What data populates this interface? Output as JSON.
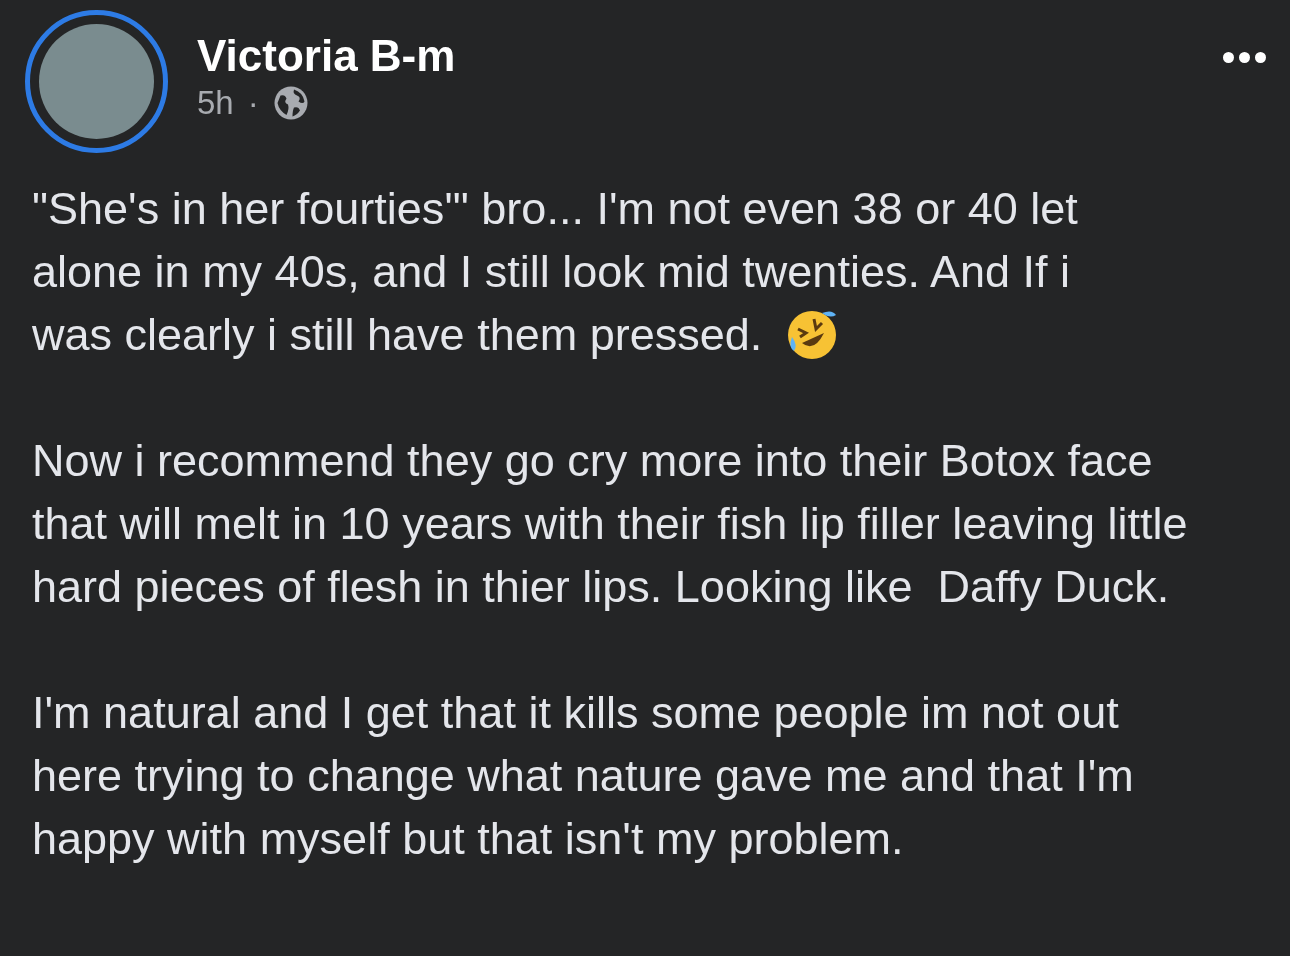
{
  "post": {
    "author": "Victoria B-m",
    "time": "5h",
    "separator": "·",
    "paragraphs": [
      {
        "text": "\"She's in her fourties'\" bro... I'm not even 38 or 40 let alone in my 40s, and I still look mid twenties. And If i",
        "last_line": "was clearly i still have them pressed."
      },
      {
        "text": "Now i recommend they go cry more into their Botox face that will melt in 10 years with their fish lip filler leaving little hard pieces of flesh in thier lips. Looking like  Daffy Duck."
      },
      {
        "text": "I'm natural and I get that it kills some people im not out here trying to change what nature gave me and that I'm happy with myself but that isn't my problem."
      }
    ]
  }
}
